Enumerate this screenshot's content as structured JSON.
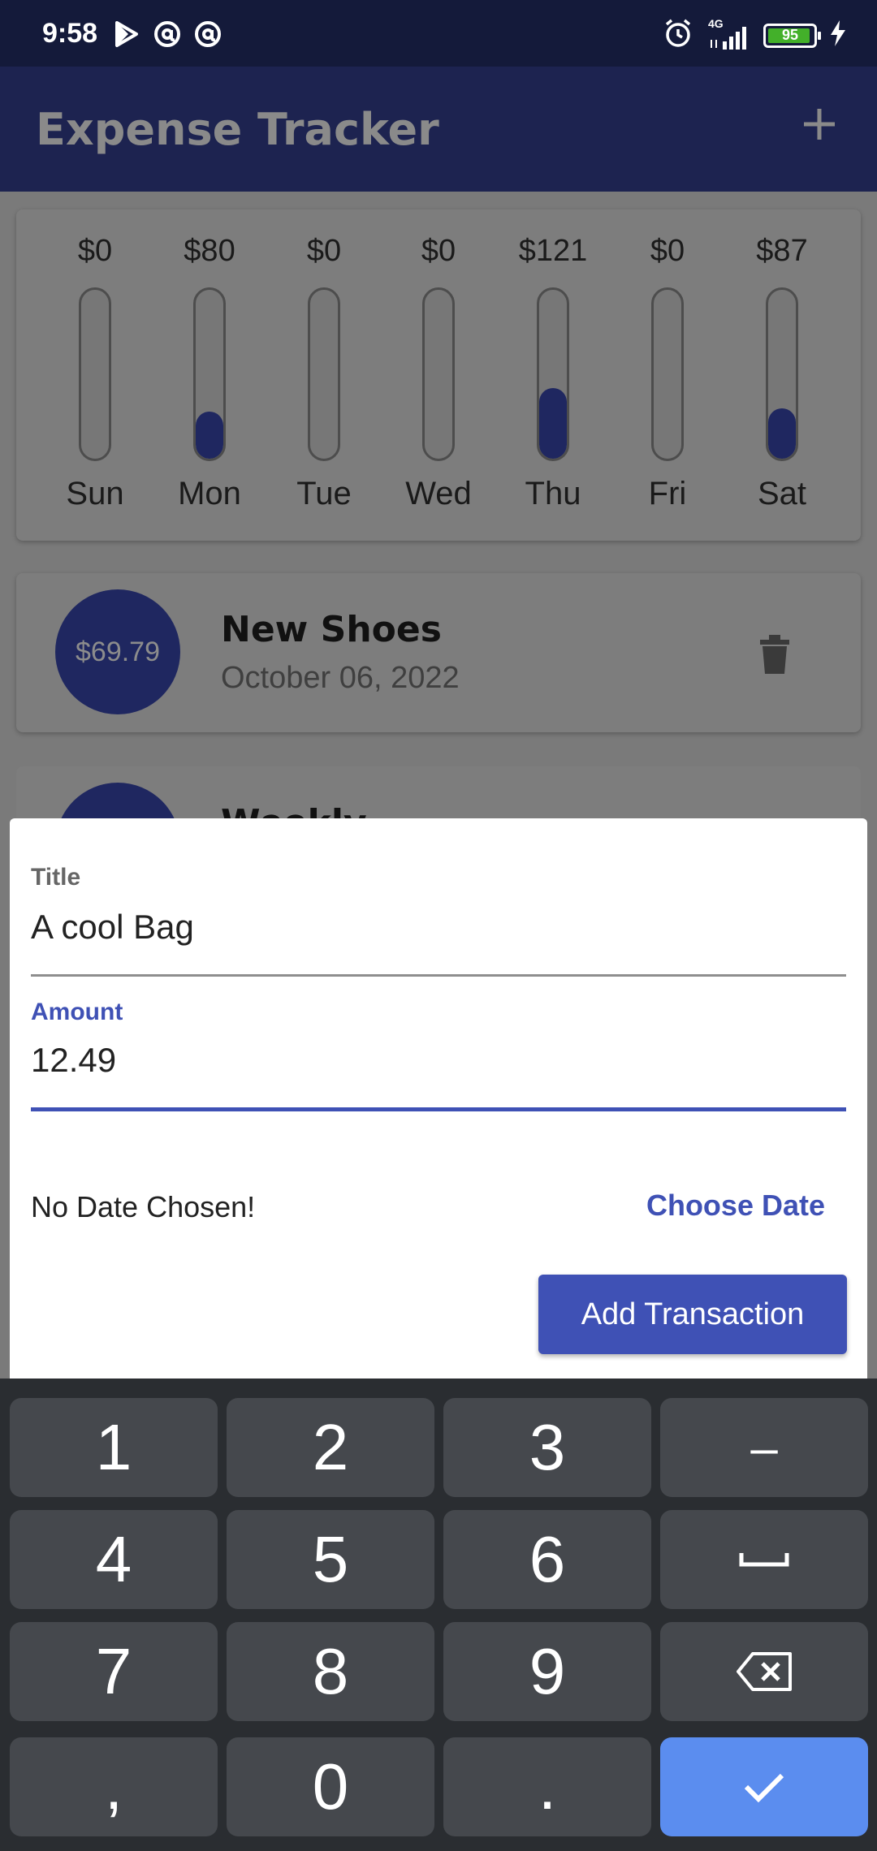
{
  "status_bar": {
    "time": "9:58",
    "network": "4G",
    "battery": "95",
    "battery_level": 0.95,
    "icons": [
      "play-store-icon",
      "at-sign-icon",
      "at-sign-icon",
      "alarm-icon",
      "signal-icon",
      "battery-icon",
      "charging-icon"
    ]
  },
  "app_bar": {
    "title": "Expense Tracker",
    "add_icon": "plus-icon"
  },
  "chart": {
    "bars": [
      {
        "amount": "$0",
        "day": "Sun",
        "fraction": 0.0
      },
      {
        "amount": "$80",
        "day": "Mon",
        "fraction": 0.28
      },
      {
        "amount": "$0",
        "day": "Tue",
        "fraction": 0.0
      },
      {
        "amount": "$0",
        "day": "Wed",
        "fraction": 0.0
      },
      {
        "amount": "$121",
        "day": "Thu",
        "fraction": 0.42
      },
      {
        "amount": "$0",
        "day": "Fri",
        "fraction": 0.0
      },
      {
        "amount": "$87",
        "day": "Sat",
        "fraction": 0.3
      }
    ],
    "fill_color": "#1f2760"
  },
  "transactions": [
    {
      "amount": "$69.79",
      "title": "New Shoes",
      "date": "October 06, 2022",
      "delete_icon": "trash-icon"
    },
    {
      "title": "Weekly"
    }
  ],
  "form": {
    "title_label": "Title",
    "title_value": "A cool Bag",
    "amount_label": "Amount",
    "amount_value": "12.49",
    "no_date_text": "No Date Chosen!",
    "choose_date_label": "Choose Date",
    "submit_label": "Add Transaction",
    "accent_color": "#3f51b5"
  },
  "keyboard": {
    "keys": [
      "1",
      "2",
      "3",
      "–",
      "4",
      "5",
      "6",
      "␣",
      "7",
      "8",
      "9",
      "⌫",
      ",",
      "0",
      ".",
      "✓"
    ],
    "done_color": "#5b8def"
  }
}
